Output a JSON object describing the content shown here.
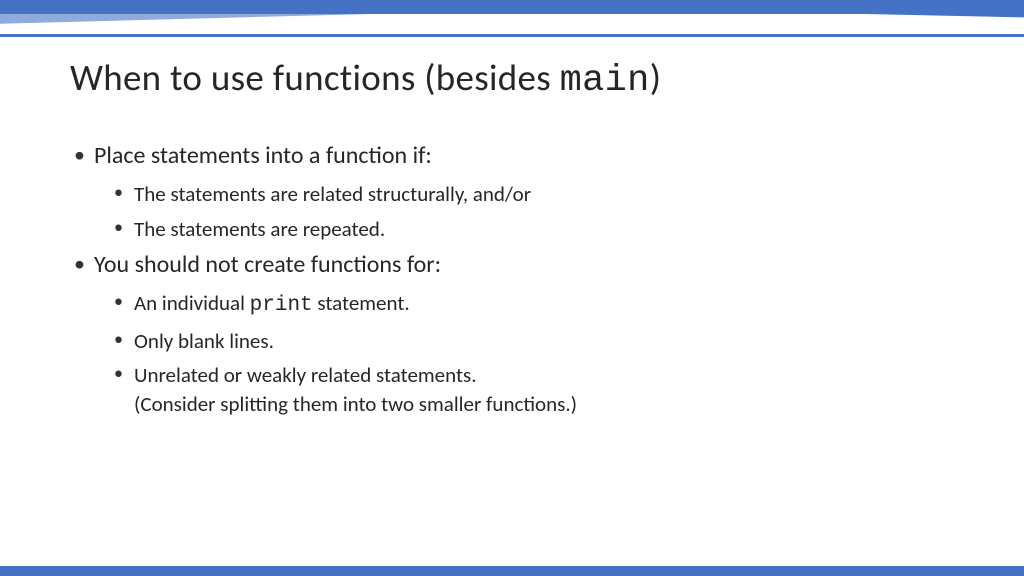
{
  "title": {
    "prefix": "When to use functions (besides ",
    "mono": "main",
    "suffix": ")"
  },
  "section1": {
    "heading": "Place statements into a function if:",
    "items": [
      "The statements are related structurally, and/or",
      "The statements are repeated."
    ]
  },
  "section2": {
    "heading": "You should not create functions for:",
    "item1_prefix": "An individual ",
    "item1_mono": "print",
    "item1_suffix": " statement.",
    "items_rest": [
      "Only blank lines.",
      "Unrelated or weakly related statements.\n(Consider splitting them into two smaller functions.)"
    ]
  }
}
